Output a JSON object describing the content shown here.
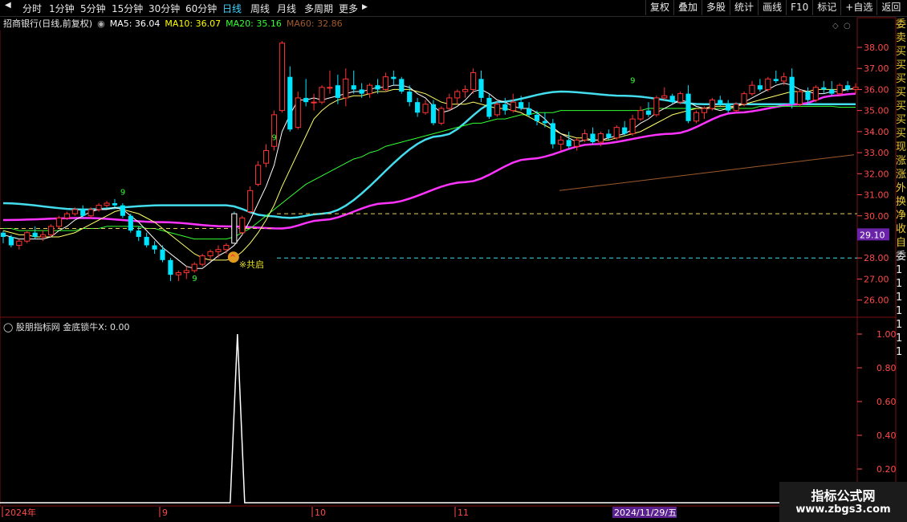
{
  "toolbar": {
    "timeframes": [
      "分时",
      "1分钟",
      "5分钟",
      "15分钟",
      "30分钟",
      "60分钟",
      "日线",
      "周线",
      "月线",
      "多周期",
      "更多"
    ],
    "active_timeframe": "日线",
    "more_arrow": "▶",
    "right_buttons": [
      "复权",
      "叠加",
      "多股",
      "统计",
      "画线",
      "F10",
      "标记",
      "+自选",
      "返回"
    ]
  },
  "main": {
    "stock_title": "招商银行(日线,前复权)",
    "ma_labels": [
      {
        "text": "MA5: 36.04",
        "color": "#ffffff"
      },
      {
        "text": "MA10: 36.07",
        "color": "#ffff00"
      },
      {
        "text": "MA20: 35.16",
        "color": "#33ff33"
      },
      {
        "text": "MA60: 32.86",
        "color": "#a05a2c"
      }
    ],
    "price_axis": [
      "38.00",
      "37.00",
      "36.00",
      "35.00",
      "34.00",
      "33.00",
      "32.00",
      "31.00",
      "30.00",
      "29.00",
      "28.00",
      "27.00",
      "26.00"
    ],
    "current_price_tag": "29.10",
    "signal_label": "※共启",
    "nine_markers": [
      "9",
      "9",
      "9",
      "9"
    ],
    "upper_dash_price": 30.1,
    "lower_dash_price": 28.0,
    "ma60_range": [
      31.2,
      32.9
    ]
  },
  "sub": {
    "title": "股朋指标网 金底锁牛X: 0.00",
    "axis": [
      "1.00",
      "0.80",
      "0.60",
      "0.40",
      "0.20"
    ],
    "peak_value": 1.0
  },
  "date_axis": {
    "labels": [
      "2024年",
      "9",
      "10",
      "11"
    ],
    "cursor_date": "2024/11/29/五"
  },
  "side_strip": {
    "chars": [
      "委",
      "卖",
      "买",
      "买",
      "买",
      "买",
      "买",
      "买",
      "买",
      "现",
      "涨",
      "涨",
      "外",
      "换",
      "净",
      "收",
      "自",
      "委",
      "1",
      "1",
      "1",
      "1",
      "1",
      "1",
      "1"
    ]
  },
  "watermark": {
    "title": "指标公式网",
    "url": "www.zbgs3.com"
  },
  "colors": {
    "up": "#ff3333",
    "down": "#00e5ff",
    "ma5": "#ffffff",
    "ma10": "#ffff66",
    "ma20": "#33ff33",
    "ma60": "#a05a2c",
    "magenta": "#ff33ff",
    "cyan_band": "#44ddee",
    "grid": "#7a1010",
    "axis_text": "#ff4a4a"
  },
  "chart_data": {
    "type": "candlestick",
    "ylim": [
      25.3,
      38.8
    ],
    "ohlc": [
      [
        29.2,
        29.3,
        28.7,
        29.0
      ],
      [
        29.0,
        29.1,
        28.5,
        28.6
      ],
      [
        28.6,
        28.9,
        28.4,
        28.8
      ],
      [
        28.8,
        29.3,
        28.7,
        29.2
      ],
      [
        29.2,
        29.5,
        28.9,
        29.0
      ],
      [
        29.0,
        29.3,
        28.8,
        29.1
      ],
      [
        29.1,
        29.6,
        29.0,
        29.5
      ],
      [
        29.5,
        30.0,
        29.4,
        29.9
      ],
      [
        29.9,
        30.2,
        29.8,
        30.1
      ],
      [
        30.1,
        30.4,
        30.0,
        30.3
      ],
      [
        30.3,
        30.5,
        29.9,
        30.0
      ],
      [
        30.0,
        30.4,
        29.9,
        30.3
      ],
      [
        30.3,
        30.6,
        30.2,
        30.5
      ],
      [
        30.5,
        30.7,
        30.4,
        30.6
      ],
      [
        30.6,
        30.8,
        30.4,
        30.5
      ],
      [
        30.5,
        30.6,
        29.9,
        30.0
      ],
      [
        30.0,
        30.1,
        29.2,
        29.3
      ],
      [
        29.3,
        29.5,
        28.8,
        29.0
      ],
      [
        29.0,
        29.2,
        28.5,
        28.6
      ],
      [
        28.6,
        28.8,
        28.2,
        28.4
      ],
      [
        28.4,
        28.6,
        27.8,
        27.9
      ],
      [
        27.9,
        28.0,
        26.9,
        27.2
      ],
      [
        27.2,
        27.4,
        26.9,
        27.3
      ],
      [
        27.3,
        27.6,
        27.0,
        27.4
      ],
      [
        27.4,
        27.8,
        27.3,
        27.7
      ],
      [
        27.7,
        28.2,
        27.6,
        28.1
      ],
      [
        28.1,
        28.4,
        27.9,
        28.3
      ],
      [
        28.3,
        28.6,
        28.0,
        28.4
      ],
      [
        28.4,
        28.7,
        28.2,
        28.6
      ],
      [
        30.1,
        30.2,
        28.7,
        28.7
      ],
      [
        29.2,
        30.0,
        29.1,
        29.9
      ],
      [
        30.2,
        31.4,
        30.1,
        31.2
      ],
      [
        31.5,
        32.6,
        31.4,
        32.4
      ],
      [
        32.5,
        33.4,
        32.3,
        33.1
      ],
      [
        33.3,
        35.0,
        33.1,
        34.8
      ],
      [
        35.0,
        38.3,
        34.9,
        38.2
      ],
      [
        36.6,
        37.1,
        34.0,
        34.1
      ],
      [
        34.2,
        35.9,
        34.1,
        35.6
      ],
      [
        35.6,
        36.5,
        35.2,
        35.4
      ],
      [
        35.4,
        35.8,
        35.0,
        35.4
      ],
      [
        35.4,
        36.2,
        35.3,
        36.1
      ],
      [
        36.1,
        36.9,
        35.8,
        36.1
      ],
      [
        36.2,
        36.7,
        35.3,
        35.6
      ],
      [
        35.6,
        37.0,
        35.2,
        36.5
      ],
      [
        36.2,
        36.9,
        35.8,
        36.0
      ],
      [
        36.0,
        36.3,
        35.6,
        35.8
      ],
      [
        35.8,
        36.3,
        35.6,
        36.2
      ],
      [
        36.2,
        36.5,
        35.8,
        36.0
      ],
      [
        36.0,
        36.8,
        35.9,
        36.6
      ],
      [
        36.6,
        36.9,
        36.2,
        36.5
      ],
      [
        36.5,
        36.6,
        35.8,
        35.9
      ],
      [
        35.9,
        36.2,
        35.2,
        35.4
      ],
      [
        35.4,
        35.6,
        34.7,
        34.9
      ],
      [
        34.9,
        35.5,
        34.8,
        35.3
      ],
      [
        35.3,
        35.5,
        34.3,
        34.4
      ],
      [
        34.4,
        35.2,
        34.3,
        35.1
      ],
      [
        35.1,
        35.8,
        35.0,
        35.6
      ],
      [
        35.6,
        36.0,
        35.3,
        35.9
      ],
      [
        35.9,
        36.2,
        35.6,
        36.0
      ],
      [
        36.0,
        37.0,
        35.8,
        36.8
      ],
      [
        36.5,
        36.9,
        35.4,
        35.6
      ],
      [
        35.6,
        35.8,
        34.6,
        34.7
      ],
      [
        34.8,
        35.4,
        34.7,
        35.3
      ],
      [
        35.3,
        35.6,
        34.8,
        35.0
      ],
      [
        35.0,
        35.8,
        34.9,
        35.4
      ],
      [
        35.4,
        35.7,
        35.0,
        35.1
      ],
      [
        35.1,
        35.4,
        34.7,
        34.8
      ],
      [
        34.8,
        35.0,
        34.3,
        34.5
      ],
      [
        34.5,
        34.9,
        34.2,
        34.4
      ],
      [
        34.4,
        34.6,
        33.2,
        33.4
      ],
      [
        33.4,
        33.8,
        33.1,
        33.6
      ],
      [
        33.6,
        34.0,
        33.2,
        33.3
      ],
      [
        33.3,
        33.7,
        33.1,
        33.6
      ],
      [
        33.6,
        34.1,
        33.5,
        33.9
      ],
      [
        33.9,
        34.2,
        33.4,
        33.5
      ],
      [
        33.5,
        34.0,
        33.3,
        33.9
      ],
      [
        33.9,
        34.1,
        33.6,
        33.7
      ],
      [
        33.7,
        34.3,
        33.6,
        34.2
      ],
      [
        34.2,
        34.5,
        33.8,
        33.9
      ],
      [
        33.9,
        34.8,
        33.8,
        34.6
      ],
      [
        34.6,
        35.2,
        34.5,
        35.0
      ],
      [
        35.0,
        35.4,
        34.7,
        34.8
      ],
      [
        34.8,
        35.7,
        34.7,
        35.6
      ],
      [
        35.6,
        36.1,
        35.5,
        35.7
      ],
      [
        35.7,
        35.8,
        35.3,
        35.4
      ],
      [
        35.4,
        35.9,
        35.3,
        35.8
      ],
      [
        35.8,
        36.2,
        34.4,
        34.5
      ],
      [
        34.5,
        35.0,
        34.4,
        34.9
      ],
      [
        34.9,
        35.2,
        34.6,
        35.1
      ],
      [
        35.1,
        35.6,
        35.0,
        35.5
      ],
      [
        35.5,
        35.7,
        35.2,
        35.3
      ],
      [
        35.3,
        35.5,
        34.9,
        35.0
      ],
      [
        35.0,
        35.4,
        34.9,
        35.3
      ],
      [
        35.3,
        35.9,
        35.2,
        35.8
      ],
      [
        35.8,
        36.4,
        35.7,
        36.2
      ],
      [
        36.2,
        36.5,
        35.9,
        36.0
      ],
      [
        36.0,
        36.6,
        35.9,
        36.5
      ],
      [
        36.5,
        36.9,
        36.3,
        36.4
      ],
      [
        36.4,
        36.8,
        36.2,
        36.6
      ],
      [
        36.6,
        37.0,
        35.1,
        35.3
      ],
      [
        35.3,
        36.0,
        35.2,
        35.9
      ],
      [
        35.9,
        36.1,
        35.3,
        35.5
      ],
      [
        35.5,
        36.2,
        35.4,
        36.1
      ],
      [
        36.1,
        36.4,
        35.8,
        36.0
      ],
      [
        36.0,
        36.4,
        35.7,
        35.8
      ],
      [
        35.8,
        36.3,
        35.7,
        36.2
      ],
      [
        36.2,
        36.4,
        35.9,
        36.0
      ],
      [
        36.0,
        36.3,
        35.8,
        36.1
      ]
    ],
    "series": [
      {
        "values_ma5": [
          29.1,
          29.0,
          28.9,
          28.9,
          28.9,
          28.9,
          29.0,
          29.3,
          29.5,
          29.8,
          30.0,
          30.2,
          30.3,
          30.3,
          30.4,
          30.3,
          30.0,
          29.7,
          29.3,
          28.9,
          28.5,
          28.2,
          27.9,
          27.6,
          27.5,
          27.5,
          27.8,
          28.1,
          28.3,
          28.6,
          29.1,
          29.8,
          30.6,
          31.4,
          32.4,
          34.0,
          34.8,
          35.5,
          35.5,
          35.6,
          35.5,
          35.6,
          35.7,
          35.8,
          35.9,
          35.9,
          36.0,
          36.1,
          36.1,
          36.2,
          36.2,
          36.1,
          35.8,
          35.6,
          35.2,
          34.9,
          35.0,
          35.2,
          35.5,
          35.9,
          36.0,
          35.8,
          35.5,
          35.4,
          35.2,
          35.1,
          35.1,
          34.9,
          34.6,
          34.2,
          33.9,
          33.7,
          33.5,
          33.6,
          33.6,
          33.6,
          33.7,
          33.8,
          33.9,
          34.1,
          34.4,
          34.6,
          34.9,
          35.1,
          35.3,
          35.5,
          35.4,
          35.2,
          35.1,
          35.1,
          35.0,
          35.1,
          35.2,
          35.4,
          35.6,
          35.8,
          36.0,
          36.2,
          36.3,
          36.2,
          36.0,
          35.9,
          35.8,
          35.8,
          35.9,
          35.9,
          36.0,
          36.04
        ]
      },
      {
        "values_ma10": [
          29.3,
          29.2,
          29.1,
          29.1,
          29.0,
          29.0,
          29.0,
          29.0,
          29.1,
          29.2,
          29.4,
          29.6,
          29.8,
          30.0,
          30.2,
          30.3,
          30.2,
          30.1,
          29.9,
          29.7,
          29.4,
          29.1,
          28.8,
          28.5,
          28.2,
          28.0,
          27.9,
          27.9,
          27.9,
          28.0,
          28.3,
          28.7,
          29.2,
          29.8,
          30.5,
          31.4,
          32.2,
          33.0,
          33.8,
          34.6,
          35.0,
          35.3,
          35.5,
          35.6,
          35.7,
          35.7,
          35.8,
          35.9,
          35.9,
          36.0,
          36.0,
          36.0,
          35.9,
          35.8,
          35.6,
          35.4,
          35.3,
          35.3,
          35.3,
          35.4,
          35.3,
          35.2,
          35.1,
          35.1,
          35.0,
          34.9,
          34.7,
          34.5,
          34.3,
          34.1,
          33.9,
          33.8,
          33.7,
          33.7,
          33.6,
          33.6,
          33.6,
          33.7,
          33.8,
          33.9,
          34.0,
          34.2,
          34.4,
          34.6,
          34.8,
          34.9,
          35.0,
          35.1,
          35.1,
          35.2,
          35.2,
          35.2,
          35.2,
          35.3,
          35.4,
          35.5,
          35.6,
          35.7,
          35.8,
          35.9,
          35.9,
          35.9,
          36.0,
          36.0,
          36.0,
          36.0,
          36.0,
          36.07
        ]
      },
      {
        "values_ma20": [
          29.4,
          29.4,
          29.3,
          29.3,
          29.3,
          29.3,
          29.3,
          29.3,
          29.3,
          29.3,
          29.4,
          29.4,
          29.4,
          29.5,
          29.5,
          29.5,
          29.5,
          29.5,
          29.4,
          29.4,
          29.3,
          29.2,
          29.1,
          29.0,
          28.9,
          28.9,
          28.9,
          28.9,
          28.9,
          29.0,
          29.2,
          29.4,
          29.7,
          30.0,
          30.3,
          30.6,
          30.9,
          31.2,
          31.5,
          31.7,
          31.9,
          32.1,
          32.3,
          32.5,
          32.7,
          32.8,
          33.0,
          33.1,
          33.3,
          33.4,
          33.5,
          33.6,
          33.7,
          33.8,
          33.9,
          34.0,
          34.1,
          34.2,
          34.3,
          34.4,
          34.4,
          34.5,
          34.6,
          34.6,
          34.7,
          34.8,
          34.8,
          34.9,
          34.9,
          34.9,
          35.0,
          35.0,
          35.0,
          35.0,
          35.0,
          35.0,
          35.0,
          35.0,
          35.0,
          35.0,
          35.0,
          35.1,
          35.1,
          35.1,
          35.1,
          35.1,
          35.1,
          35.1,
          35.1,
          35.1,
          35.1,
          35.1,
          35.1,
          35.1,
          35.1,
          35.2,
          35.2,
          35.2,
          35.2,
          35.2,
          35.2,
          35.2,
          35.2,
          35.2,
          35.2,
          35.16,
          35.16,
          35.16
        ]
      }
    ]
  }
}
